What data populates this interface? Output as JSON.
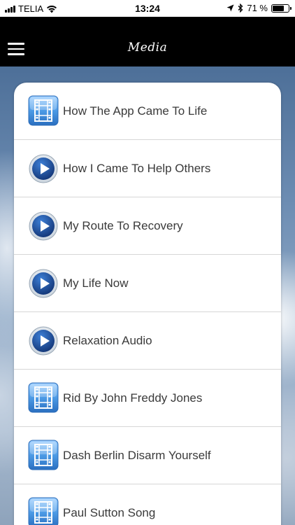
{
  "status_bar": {
    "carrier": "TELIA",
    "time": "13:24",
    "battery_text": "71 %",
    "battery_level": 0.71
  },
  "nav": {
    "title": "Media"
  },
  "media_items": [
    {
      "label": "How The App Came To Life",
      "icon": "film-icon"
    },
    {
      "label": "How I Came To Help Others",
      "icon": "play-icon"
    },
    {
      "label": "My Route To Recovery",
      "icon": "play-icon"
    },
    {
      "label": "My Life Now",
      "icon": "play-icon"
    },
    {
      "label": "Relaxation Audio",
      "icon": "play-icon"
    },
    {
      "label": "Rid By John Freddy Jones",
      "icon": "film-icon"
    },
    {
      "label": "Dash Berlin Disarm Yourself",
      "icon": "film-icon"
    },
    {
      "label": "Paul Sutton Song",
      "icon": "film-icon"
    }
  ],
  "colors": {
    "nav_background": "#000000",
    "card_background": "#ffffff",
    "label_text": "#3a3a3a",
    "icon_blue": "#2f7fd0"
  }
}
